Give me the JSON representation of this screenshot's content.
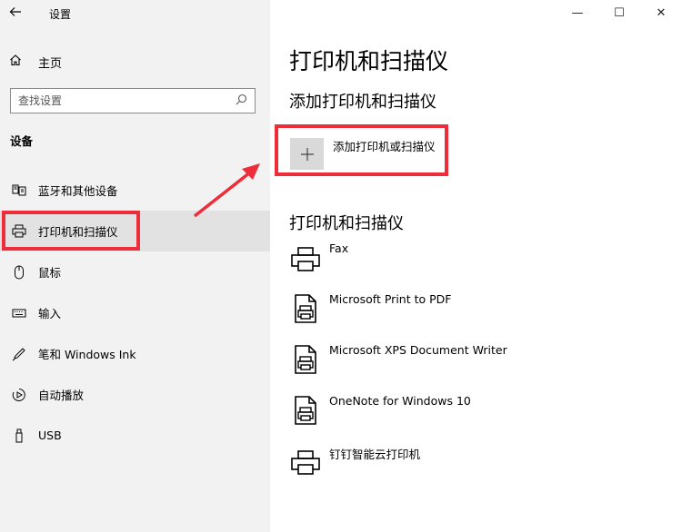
{
  "window": {
    "title": "设置",
    "back_icon": "arrow-left-icon",
    "minimize": "—",
    "maximize": "☐",
    "close": "✕"
  },
  "sidebar": {
    "home_label": "主页",
    "search_placeholder": "查找设置",
    "section_label": "设备",
    "items": [
      {
        "label": "蓝牙和其他设备",
        "icon": "bluetooth-devices-icon"
      },
      {
        "label": "打印机和扫描仪",
        "icon": "printer-icon",
        "selected": true
      },
      {
        "label": "鼠标",
        "icon": "mouse-icon"
      },
      {
        "label": "输入",
        "icon": "keyboard-icon"
      },
      {
        "label": "笔和 Windows Ink",
        "icon": "pen-icon"
      },
      {
        "label": "自动播放",
        "icon": "autoplay-icon"
      },
      {
        "label": "USB",
        "icon": "usb-icon"
      }
    ]
  },
  "main": {
    "title": "打印机和扫描仪",
    "add_section_title": "添加打印机和扫描仪",
    "add_button_label": "添加打印机或扫描仪",
    "list_section_title": "打印机和扫描仪",
    "printers": [
      {
        "name": "Fax",
        "icon": "printer-icon"
      },
      {
        "name": "Microsoft Print to PDF",
        "icon": "document-printer-icon"
      },
      {
        "name": "Microsoft XPS Document Writer",
        "icon": "document-printer-icon"
      },
      {
        "name": "OneNote for Windows 10",
        "icon": "document-printer-icon"
      },
      {
        "name": "钉钉智能云打印机",
        "icon": "printer-icon"
      }
    ]
  },
  "colors": {
    "highlight": "#ee2d3b",
    "sidebar_bg": "#f2f2f2",
    "selected_bg": "#e2e2e2",
    "add_button_bg": "#d9d9d9"
  }
}
